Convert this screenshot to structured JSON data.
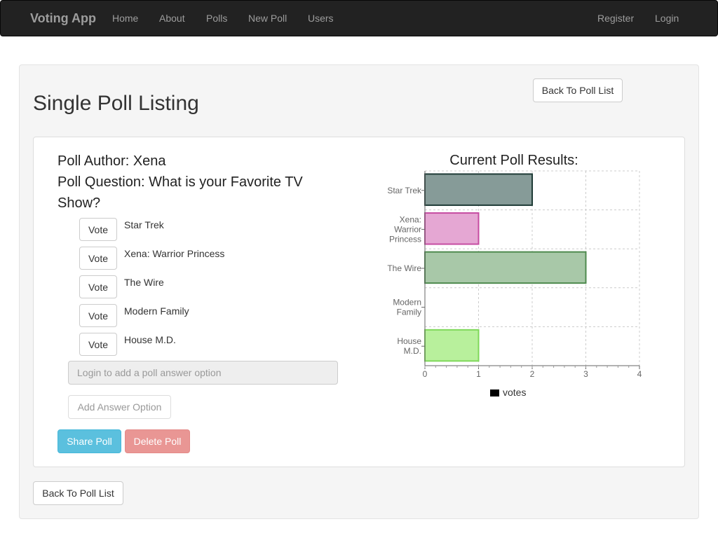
{
  "navbar": {
    "brand": "Voting App",
    "links": [
      "Home",
      "About",
      "Polls",
      "New Poll",
      "Users"
    ],
    "right_links": [
      "Register",
      "Login"
    ]
  },
  "page": {
    "title": "Single Poll Listing",
    "back_button_top": "Back To Poll List",
    "back_button_bottom": "Back To Poll List"
  },
  "poll": {
    "author_line": "Poll Author: Xena",
    "question_line1": "Poll Question: What is your Favorite TV",
    "question_line2": "Show?",
    "vote_label": "Vote",
    "options": [
      "Star Trek",
      "Xena: Warrior Princess",
      "The Wire",
      "Modern Family",
      "House M.D."
    ],
    "add_option_placeholder": "Login to add a poll answer option",
    "add_option_button": "Add Answer Option",
    "share_button": "Share Poll",
    "delete_button": "Delete Poll"
  },
  "colors": {
    "navbar_bg": "#222222",
    "share": "#5bc0de",
    "delete": "#e99694"
  },
  "chart_data": {
    "type": "bar",
    "orientation": "horizontal",
    "title": "Current Poll Results:",
    "category_lines": [
      [
        "Star Trek"
      ],
      [
        "Xena:",
        "Warrior",
        "Princess"
      ],
      [
        "The Wire"
      ],
      [
        "Modern",
        "Family"
      ],
      [
        "House",
        "M.D."
      ]
    ],
    "series": [
      {
        "name": "votes",
        "values": [
          2,
          1,
          3,
          0,
          1
        ]
      }
    ],
    "fills": [
      "#869b98",
      "#e5a7d3",
      "#a8c8a8",
      "#cccccc",
      "#b8f09c"
    ],
    "strokes": [
      "#1e3b36",
      "#c64ca2",
      "#4e8a4e",
      "#999999",
      "#7fd85a"
    ],
    "xlim": [
      0,
      4
    ],
    "xticks": [
      0,
      1,
      2,
      3,
      4
    ],
    "grid": true,
    "legend_position": "bottom"
  }
}
